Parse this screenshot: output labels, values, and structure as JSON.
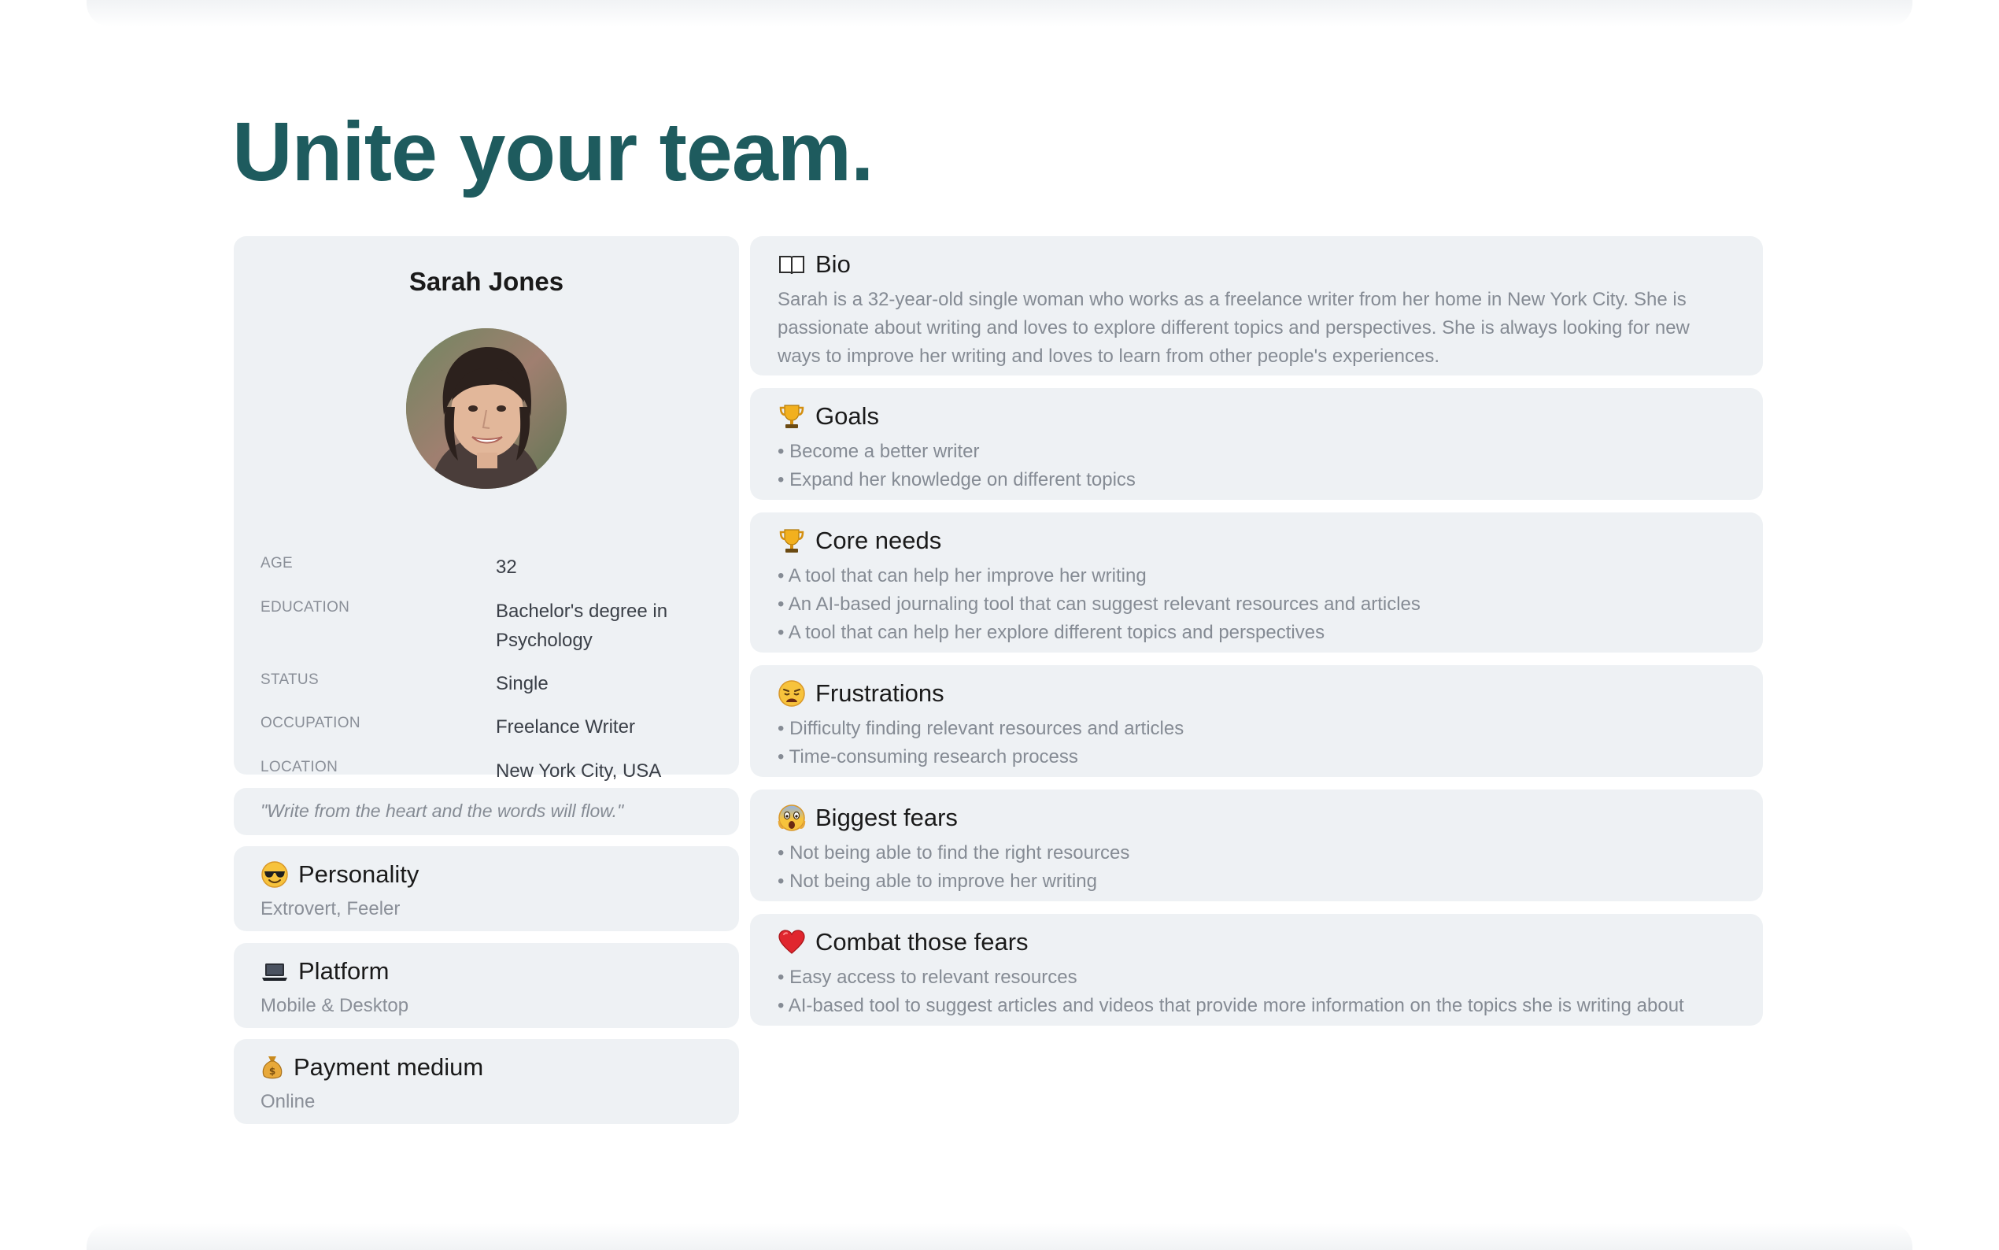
{
  "headline": "Unite your team.",
  "profile": {
    "name": "Sarah Jones",
    "attributes": [
      {
        "label": "AGE",
        "value": "32"
      },
      {
        "label": "EDUCATION",
        "value": "Bachelor's degree in Psychology"
      },
      {
        "label": "STATUS",
        "value": "Single"
      },
      {
        "label": "OCCUPATION",
        "value": "Freelance Writer"
      },
      {
        "label": "LOCATION",
        "value": "New York City, USA"
      }
    ]
  },
  "quote": "\"Write from the heart and the words will flow.\"",
  "personality": {
    "icon": "sunglasses-face-icon",
    "title": "Personality",
    "value": "Extrovert, Feeler"
  },
  "platform": {
    "icon": "laptop-icon",
    "title": "Platform",
    "value": "Mobile & Desktop"
  },
  "payment": {
    "icon": "money-bag-icon",
    "title": "Payment medium",
    "value": "Online"
  },
  "bio": {
    "icon": "book-icon",
    "title": "Bio",
    "text": "Sarah is a 32-year-old single woman who works as a freelance writer from her home in New York City. She is passionate about writing and loves to explore different topics and perspectives. She is always looking for new ways to improve her writing and loves to learn from other people's experiences."
  },
  "goals": {
    "icon": "trophy-icon",
    "title": "Goals",
    "items": [
      "Become a better writer",
      "Expand her knowledge on different topics"
    ]
  },
  "core_needs": {
    "icon": "trophy-icon",
    "title": "Core needs",
    "items": [
      "A tool that can help her improve her writing",
      "An AI-based journaling tool that can suggest relevant resources and articles",
      "A tool that can help her explore different topics and perspectives"
    ]
  },
  "frustrations": {
    "icon": "weary-face-icon",
    "title": "Frustrations",
    "items": [
      "Difficulty finding relevant resources and articles",
      "Time-consuming research process"
    ]
  },
  "fears": {
    "icon": "screaming-face-icon",
    "title": "Biggest fears",
    "items": [
      "Not being able to find the right resources",
      "Not being able to improve her writing"
    ]
  },
  "combat": {
    "icon": "red-heart-icon",
    "title": "Combat those fears",
    "items": [
      "Easy access to relevant resources",
      "AI-based tool to suggest articles and videos that provide more information on the topics she is writing about"
    ]
  }
}
